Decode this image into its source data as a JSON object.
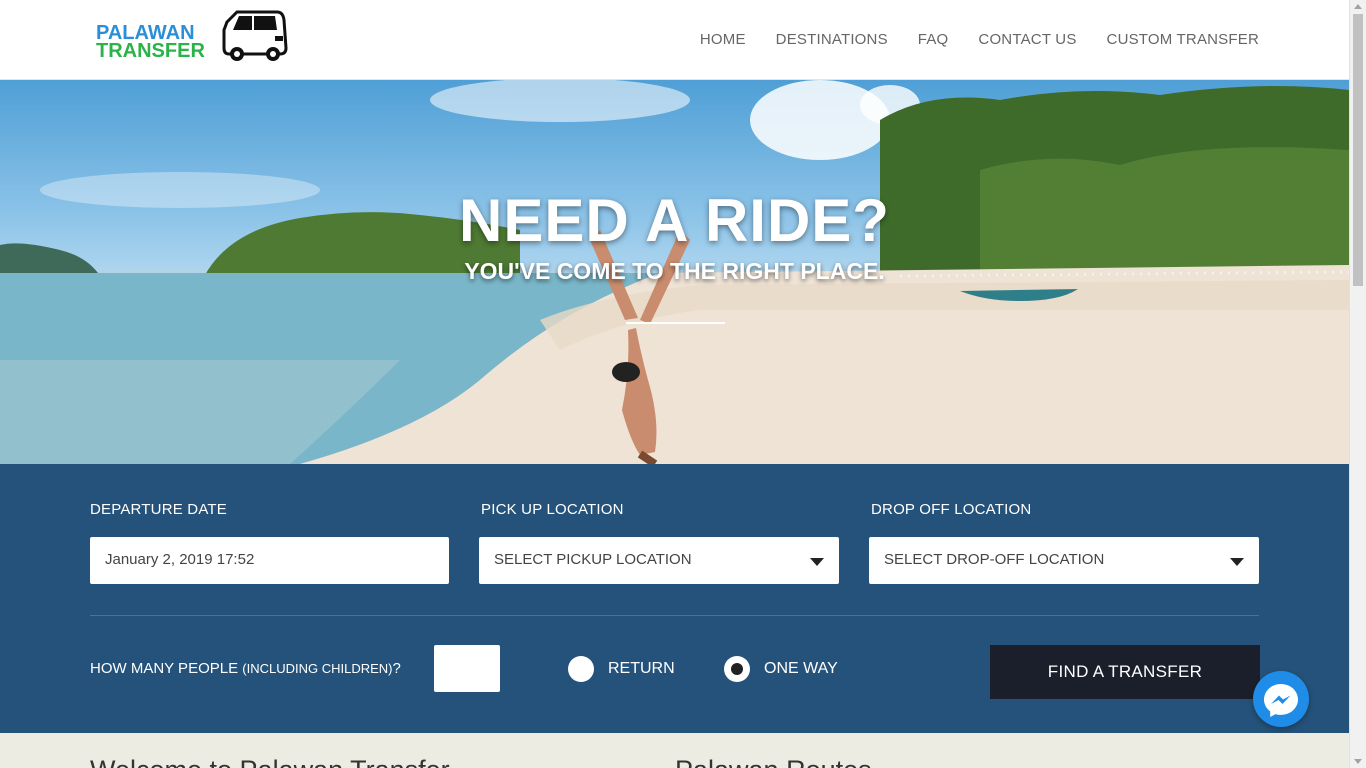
{
  "logo": {
    "line1": "PALAWAN",
    "line2": "TRANSFER",
    "icon": "van-icon"
  },
  "nav": {
    "items": [
      "HOME",
      "DESTINATIONS",
      "FAQ",
      "CONTACT US",
      "CUSTOM TRANSFER"
    ]
  },
  "hero": {
    "title": "NEED A RIDE?",
    "subtitle": "YOU'VE COME TO THE RIGHT PLACE."
  },
  "booking": {
    "departure_label": "DEPARTURE DATE",
    "departure_value": "January 2, 2019 17:52",
    "pickup_label": "PICK UP LOCATION",
    "pickup_value": "SELECT PICKUP LOCATION",
    "dropoff_label": "DROP OFF LOCATION",
    "dropoff_value": "SELECT DROP-OFF LOCATION",
    "people_label": "HOW MANY PEOPLE",
    "people_sub": "(INCLUDING CHILDREN)",
    "people_suffix": "?",
    "people_value": "",
    "return_label": "RETURN",
    "oneway_label": "ONE WAY",
    "selected_trip": "ONE WAY",
    "find_button": "FIND A TRANSFER"
  },
  "bottom": {
    "left_heading": "Welcome to Palawan Transfer",
    "right_heading": "Palawan Routes"
  },
  "colors": {
    "panel": "#25527a",
    "button": "#1b1f2b",
    "strip": "#edece2",
    "messenger": "#1f8ce8"
  }
}
